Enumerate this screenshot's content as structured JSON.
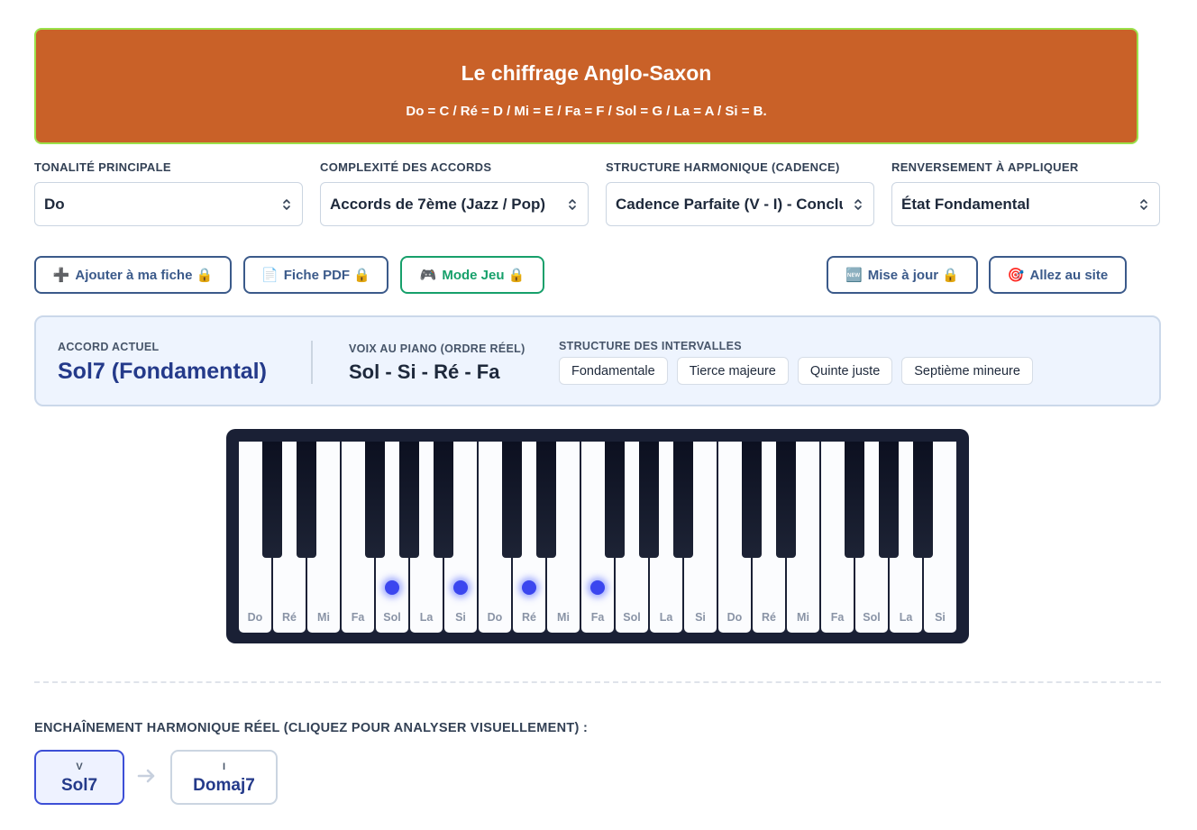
{
  "banner": {
    "title": "Le chiffrage Anglo-Saxon",
    "subtitle": "Do = C / Ré = D / Mi = E / Fa = F / Sol = G / La = A / Si = B."
  },
  "controls": [
    {
      "label": "TONALITÉ PRINCIPALE",
      "value": "Do"
    },
    {
      "label": "COMPLEXITÉ DES ACCORDS",
      "value": "Accords de 7ème (Jazz / Pop)"
    },
    {
      "label": "STRUCTURE HARMONIQUE (CADENCE)",
      "value": "Cadence Parfaite (V - I) - Conclusion"
    },
    {
      "label": "RENVERSEMENT À APPLIQUER",
      "value": "État Fondamental"
    }
  ],
  "buttons": {
    "add": {
      "icon": "➕",
      "label": "Ajouter à ma fiche 🔒"
    },
    "pdf": {
      "icon": "📄",
      "label": "Fiche PDF 🔒"
    },
    "game": {
      "icon": "🎮",
      "label": "Mode Jeu 🔒"
    },
    "update": {
      "icon": "🆕",
      "label": "Mise à jour 🔒"
    },
    "site": {
      "icon": "🎯",
      "label": "Allez au site"
    }
  },
  "info": {
    "current_label": "ACCORD ACTUEL",
    "current_chord": "Sol7 (Fondamental)",
    "voices_label": "VOIX AU PIANO (ORDRE RÉEL)",
    "voices": "Sol - Si - Ré - Fa",
    "intervals_label": "STRUCTURE DES INTERVALLES",
    "intervals": [
      "Fondamentale",
      "Tierce majeure",
      "Quinte juste",
      "Septième mineure"
    ]
  },
  "piano": {
    "white_keys": [
      "Do",
      "Ré",
      "Mi",
      "Fa",
      "Sol",
      "La",
      "Si",
      "Do",
      "Ré",
      "Mi",
      "Fa",
      "Sol",
      "La",
      "Si",
      "Do",
      "Ré",
      "Mi",
      "Fa",
      "Sol",
      "La",
      "Si"
    ],
    "active_keys": [
      4,
      6,
      8,
      10
    ],
    "accent_color": "#3b46ef"
  },
  "sequence": {
    "label": "ENCHAÎNEMENT HARMONIQUE RÉEL (CLIQUEZ POUR ANALYSER VISUELLEMENT) :",
    "items": [
      {
        "roman": "V",
        "name": "Sol7",
        "active": true
      },
      {
        "roman": "I",
        "name": "Domaj7",
        "active": false
      }
    ]
  },
  "colors": {
    "banner": "#c96128",
    "banner_border": "#9be04a",
    "primary": "#3b5a8a",
    "game": "#17a06b"
  }
}
